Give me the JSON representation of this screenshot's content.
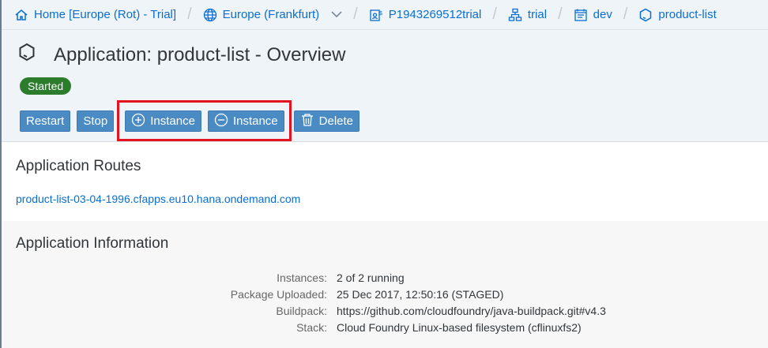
{
  "breadcrumbs": [
    {
      "label": "Home [Europe (Rot) - Trial]",
      "icon": "home-icon"
    },
    {
      "label": "Europe (Frankfurt)",
      "icon": "globe-icon"
    },
    {
      "label": "P1943269512trial",
      "icon": "account-icon"
    },
    {
      "label": "trial",
      "icon": "org-icon"
    },
    {
      "label": "dev",
      "icon": "space-icon"
    },
    {
      "label": "product-list",
      "icon": "app-icon"
    }
  ],
  "page_title": "Application: product-list - Overview",
  "status": "Started",
  "colors": {
    "status": "#2b7d2b",
    "accent": "#0a6ed1",
    "highlight": "#e3141f"
  },
  "buttons": {
    "restart": "Restart",
    "stop": "Stop",
    "add_instance": "Instance",
    "remove_instance": "Instance",
    "delete": "Delete"
  },
  "routes": {
    "title": "Application Routes",
    "url": "product-list-03-04-1996.cfapps.eu10.hana.ondemand.com"
  },
  "info": {
    "title": "Application Information",
    "rows": [
      {
        "label": "Instances:",
        "value": "2 of 2 running"
      },
      {
        "label": "Package Uploaded:",
        "value": "25 Dec 2017, 12:50:16 (STAGED)"
      },
      {
        "label": "Buildpack:",
        "value": "https://github.com/cloudfoundry/java-buildpack.git#v4.3"
      },
      {
        "label": "Stack:",
        "value": "Cloud Foundry Linux-based filesystem (cflinuxfs2)"
      }
    ]
  }
}
